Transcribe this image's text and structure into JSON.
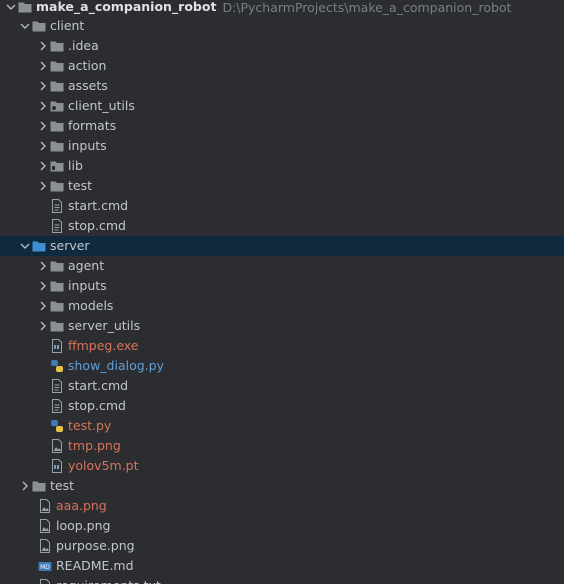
{
  "project": {
    "name": "make_a_companion_robot",
    "path": "D:\\PycharmProjects\\make_a_companion_robot"
  },
  "colors": {
    "background": "#2b2d30",
    "selection": "#0f2a3f",
    "folder_icon": "#8c9096",
    "folder_selected": "#3d8fd1",
    "text": "#c3c6cc",
    "untracked_red": "#d6735a",
    "modified_blue": "#5f9fd9"
  },
  "rows": [
    {
      "label": "make_a_companion_robot",
      "type": "root",
      "chevron": "down",
      "icon": "folder-icon"
    },
    {
      "label": "client",
      "type": "folder",
      "chevron": "down",
      "icon": "folder-icon"
    },
    {
      "label": ".idea",
      "type": "folder",
      "chevron": "right",
      "icon": "folder-icon"
    },
    {
      "label": "action",
      "type": "folder",
      "chevron": "right",
      "icon": "folder-icon"
    },
    {
      "label": "assets",
      "type": "folder",
      "chevron": "right",
      "icon": "folder-icon"
    },
    {
      "label": "client_utils",
      "type": "folder",
      "chevron": "right",
      "icon": "package-folder-icon"
    },
    {
      "label": "formats",
      "type": "folder",
      "chevron": "right",
      "icon": "folder-icon"
    },
    {
      "label": "inputs",
      "type": "folder",
      "chevron": "right",
      "icon": "folder-icon"
    },
    {
      "label": "lib",
      "type": "folder",
      "chevron": "right",
      "icon": "package-folder-icon"
    },
    {
      "label": "test",
      "type": "folder",
      "chevron": "right",
      "icon": "folder-icon"
    },
    {
      "label": "start.cmd",
      "type": "file",
      "icon": "text-file-icon"
    },
    {
      "label": "stop.cmd",
      "type": "file",
      "icon": "text-file-icon"
    },
    {
      "label": "server",
      "type": "folder",
      "chevron": "down",
      "icon": "folder-icon",
      "selected": true
    },
    {
      "label": "agent",
      "type": "folder",
      "chevron": "right",
      "icon": "folder-icon"
    },
    {
      "label": "inputs",
      "type": "folder",
      "chevron": "right",
      "icon": "folder-icon"
    },
    {
      "label": "models",
      "type": "folder",
      "chevron": "right",
      "icon": "folder-icon"
    },
    {
      "label": "server_utils",
      "type": "folder",
      "chevron": "right",
      "icon": "folder-icon"
    },
    {
      "label": "ffmpeg.exe",
      "type": "file",
      "icon": "binary-file-icon",
      "status": "red"
    },
    {
      "label": "show_dialog.py",
      "type": "file",
      "icon": "python-file-icon",
      "status": "blue"
    },
    {
      "label": "start.cmd",
      "type": "file",
      "icon": "text-file-icon"
    },
    {
      "label": "stop.cmd",
      "type": "file",
      "icon": "text-file-icon"
    },
    {
      "label": "test.py",
      "type": "file",
      "icon": "python-file-icon",
      "status": "red"
    },
    {
      "label": "tmp.png",
      "type": "file",
      "icon": "image-file-icon",
      "status": "red"
    },
    {
      "label": "yolov5m.pt",
      "type": "file",
      "icon": "binary-file-icon",
      "status": "red"
    },
    {
      "label": "test",
      "type": "folder",
      "chevron": "right",
      "icon": "folder-icon"
    },
    {
      "label": "aaa.png",
      "type": "file",
      "icon": "image-file-icon",
      "status": "red"
    },
    {
      "label": "loop.png",
      "type": "file",
      "icon": "image-file-icon"
    },
    {
      "label": "purpose.png",
      "type": "file",
      "icon": "image-file-icon"
    },
    {
      "label": "README.md",
      "type": "file",
      "icon": "markdown-file-icon"
    },
    {
      "label": "requirements.txt",
      "type": "file",
      "icon": "text-file-icon"
    }
  ]
}
